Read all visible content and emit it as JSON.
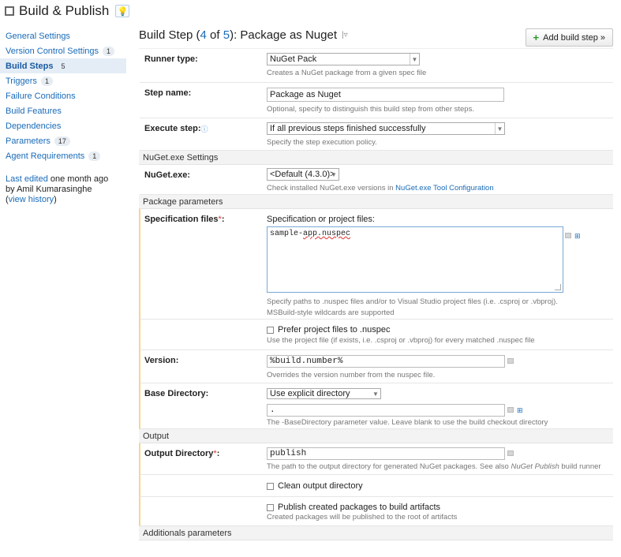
{
  "header": {
    "title": "Build & Publish"
  },
  "sidebar": {
    "items": [
      {
        "label": "General Settings",
        "count": ""
      },
      {
        "label": "Version Control Settings",
        "count": "1"
      },
      {
        "label": "Build Steps",
        "count": "5"
      },
      {
        "label": "Triggers",
        "count": "1"
      },
      {
        "label": "Failure Conditions",
        "count": ""
      },
      {
        "label": "Build Features",
        "count": ""
      },
      {
        "label": "Dependencies",
        "count": ""
      },
      {
        "label": "Parameters",
        "count": "17"
      },
      {
        "label": "Agent Requirements",
        "count": "1"
      }
    ],
    "last_edited_link": "Last edited",
    "last_edited_when": " one month ago",
    "last_edited_by": "by Amil Kumarasinghe",
    "view_history": "view history"
  },
  "main": {
    "step_prefix": "Build Step (",
    "step_num": "4",
    "step_of": " of ",
    "step_total": "5",
    "step_suffix": "): Package as Nuget",
    "add_step": "Add build step »",
    "runner_type": {
      "label": "Runner type:",
      "value": "NuGet Pack",
      "note": "Creates a NuGet package from a given spec file"
    },
    "step_name": {
      "label": "Step name:",
      "value": "Package as Nuget",
      "note": "Optional, specify to distinguish this build step from other steps."
    },
    "execute_step": {
      "label": "Execute step:",
      "value": "If all previous steps finished successfully",
      "note": "Specify the step execution policy."
    },
    "nuget_section": "NuGet.exe Settings",
    "nuget_exe": {
      "label": "NuGet.exe:",
      "value": "<Default (4.3.0)>",
      "note": "Check installed NuGet.exe versions in ",
      "note_link": "NuGet.exe Tool Configuration"
    },
    "package_section": "Package parameters",
    "spec_files": {
      "label": "Specification files",
      "caption": "Specification or project files:",
      "value_a": "sample-",
      "value_b": "app.nuspec",
      "note": "Specify paths to .nuspec files and/or to Visual Studio project files (i.e. .csproj or .vbproj). MSBuild-style wildcards are supported"
    },
    "prefer_project": {
      "label": "Prefer project files to .nuspec",
      "note": "Use the project file (if exists, i.e. .csproj or .vbproj) for every matched .nuspec file"
    },
    "version": {
      "label": "Version:",
      "value": "%build.number%",
      "note": "Overrides the version number from the nuspec file."
    },
    "base_dir": {
      "label": "Base Directory:",
      "select": "Use explicit directory",
      "value": ".",
      "note": "The -BaseDirectory parameter value. Leave blank to use the build checkout directory"
    },
    "output_section": "Output",
    "output_dir": {
      "label": "Output Directory",
      "value": "publish",
      "note": "The path to the output directory for generated NuGet packages. See also ",
      "note_em": "NuGet Publish",
      "note_end": " build runner"
    },
    "clean_output": {
      "label": "Clean output directory"
    },
    "publish_artifacts": {
      "label": "Publish created packages to build artifacts",
      "note": "Created packages will be published to the root of artifacts"
    },
    "additional_section": "Additionals parameters"
  },
  "colors": {
    "link": "#1a6bb8",
    "highlight": "#f7d58b",
    "active": "#e4edf6"
  }
}
